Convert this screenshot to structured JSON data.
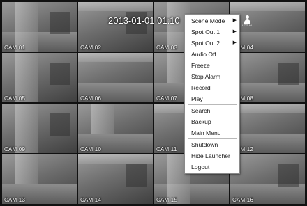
{
  "timestamp": "2013-01-01 01:10",
  "login_label": "LOG IN",
  "cameras": [
    "CAM 01",
    "CAM 02",
    "CAM 03",
    "CAM 04",
    "CAM 05",
    "CAM 06",
    "CAM 07",
    "CAM 08",
    "CAM 09",
    "CAM 10",
    "CAM 11",
    "CAM 12",
    "CAM 13",
    "CAM 14",
    "CAM 15",
    "CAM 16"
  ],
  "menu": {
    "groups": [
      [
        {
          "label": "Scene Mode",
          "submenu": true
        },
        {
          "label": "Spot Out 1",
          "submenu": true
        },
        {
          "label": "Spot Out 2",
          "submenu": true
        },
        {
          "label": "Audio Off"
        },
        {
          "label": "Freeze"
        },
        {
          "label": "Stop Alarm"
        },
        {
          "label": "Record"
        },
        {
          "label": "Play"
        }
      ],
      [
        {
          "label": "Search"
        },
        {
          "label": "Backup"
        },
        {
          "label": "Main Menu"
        }
      ],
      [
        {
          "label": "Shutdown"
        },
        {
          "label": "Hide Launcher"
        },
        {
          "label": "Logout"
        }
      ]
    ],
    "submenu_arrow": "▶"
  }
}
